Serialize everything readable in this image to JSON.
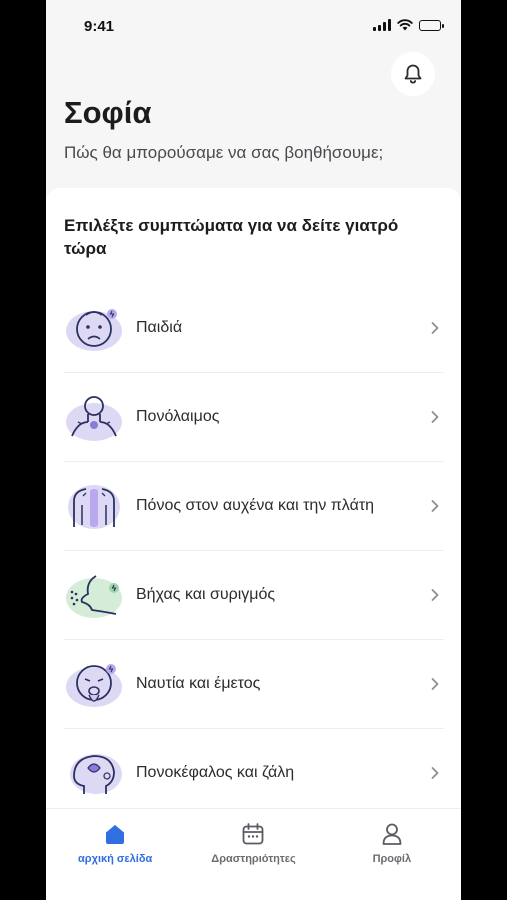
{
  "status_bar": {
    "time": "9:41"
  },
  "header": {
    "greeting": "Σοφία",
    "subtitle": "Πώς θα μπορούσαμε να σας βοηθήσουμε;"
  },
  "section": {
    "title": "Επιλέξτε συμπτώματα για να δείτε γιατρό τώρα"
  },
  "symptoms": [
    {
      "label": "Παιδιά",
      "icon": "child-face-icon"
    },
    {
      "label": "Πονόλαιμος",
      "icon": "sore-throat-icon"
    },
    {
      "label": "Πόνος στον αυχένα και την πλάτη",
      "icon": "back-pain-icon"
    },
    {
      "label": "Βήχας και συριγμός",
      "icon": "cough-icon"
    },
    {
      "label": "Ναυτία και έμετος",
      "icon": "nausea-icon"
    },
    {
      "label": "Πονοκέφαλος και ζάλη",
      "icon": "headache-icon"
    }
  ],
  "tabbar": {
    "home": "αρχική σελίδα",
    "activities": "Δραστηριότητες",
    "profile": "Προφίλ"
  },
  "colors": {
    "accent": "#2f6fe0",
    "illustration_blob": "#ddd9f5",
    "illustration_line": "#2a3160"
  }
}
